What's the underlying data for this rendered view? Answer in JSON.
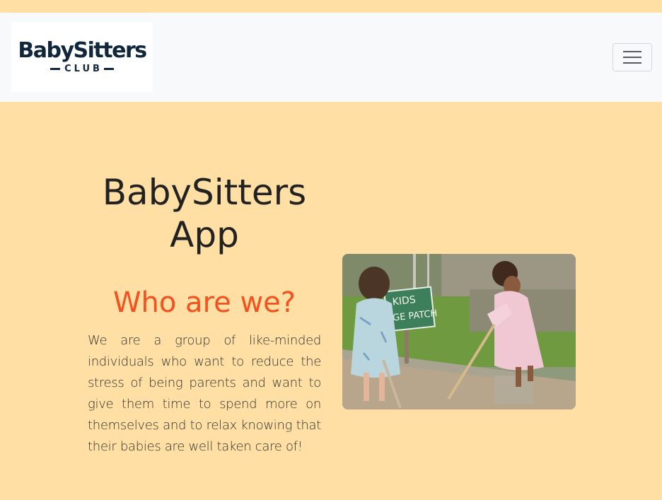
{
  "navbar": {
    "logo": {
      "word": "BabySitters",
      "sub": "CLUB"
    },
    "toggler_label": "Toggle navigation"
  },
  "hero": {
    "title": "BabySitters App"
  },
  "about": {
    "heading": "Who are we?",
    "text": "We are a group of like-minded individuals who want to reduce the stress of being parents and want to give them time to spend more on themselves and to relax knowing that their babies are well taken care of!"
  },
  "photo": {
    "sign_line1": "KIDS",
    "sign_line2": "GE PATCH"
  },
  "colors": {
    "page_bg": "#ffdfa3",
    "navbar_bg": "#f8f9fa",
    "accent": "#f4511e",
    "logo": "#10263a"
  }
}
